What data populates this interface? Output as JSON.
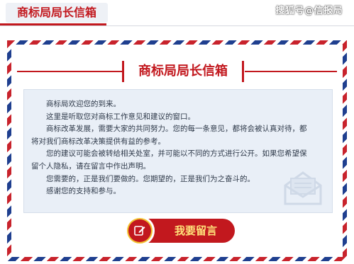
{
  "header": {
    "title": "商标局局长信箱",
    "watermark": "搜狐号@信报局"
  },
  "banner": {
    "title": "商标局局长信箱"
  },
  "message": {
    "lines": [
      "商标局欢迎您的到来。",
      "这里是听取您对商标工作意见和建议的窗口。",
      "商标改革发展，需要大家的共同努力。您的每一条意见，都将会被认真对待，都",
      "将对我们商标改革决策提供有益的参考。",
      "您的建议可能会被转给相关处室，并可能以不同的方式进行公开。如果您希望保",
      "留个人隐私，请在留言中作出声明。",
      "您需要的，正是我们要做的。您期望的，正是我们为之奋斗的。",
      "感谢您的支持和参与。"
    ]
  },
  "leave_button": {
    "label": "我要留言",
    "icon": "edit-icon"
  },
  "colors": {
    "brand_red": "#c2181e",
    "airmail_blue": "#1f3f8f",
    "button_gold": "#f2c230",
    "panel_bg": "#e9eff7"
  }
}
